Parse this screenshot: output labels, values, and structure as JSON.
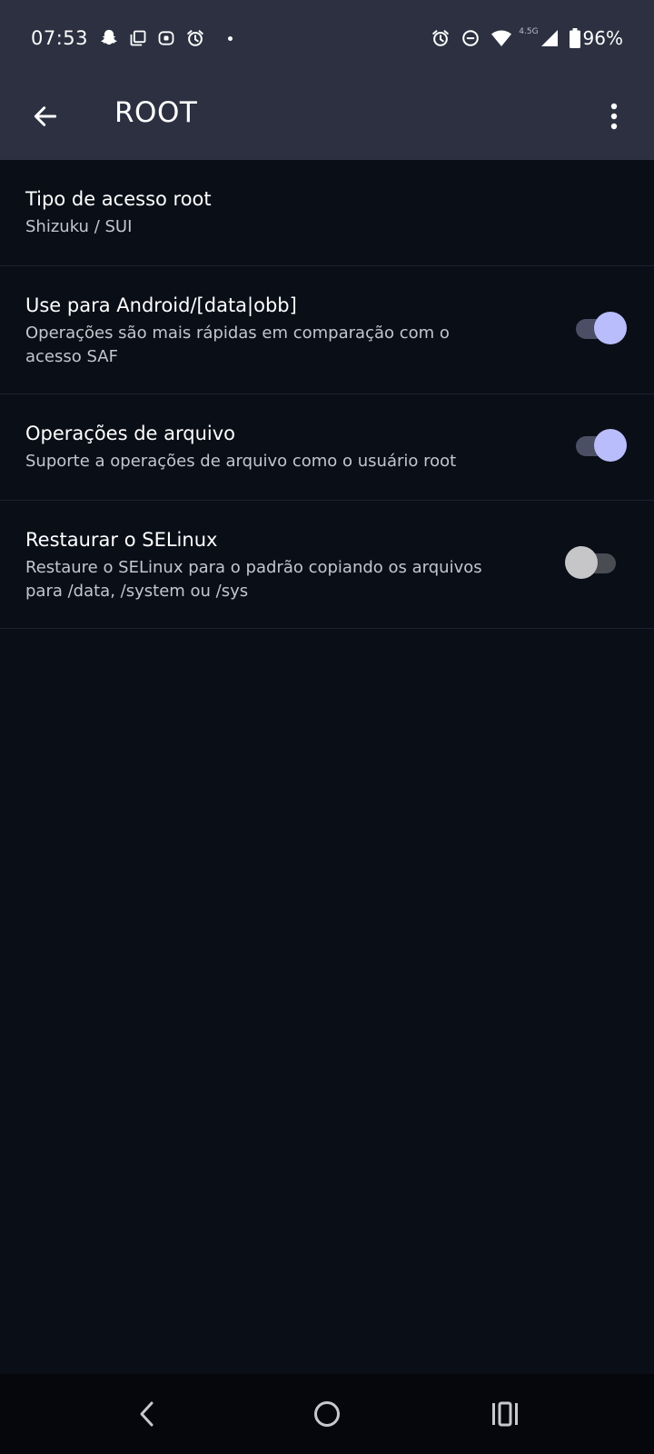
{
  "status_bar": {
    "time": "07:53",
    "left_icons": [
      "snapchat-icon",
      "copy-icon",
      "screen-record-icon",
      "alarm-icon",
      "dot-icon"
    ],
    "right_icons": [
      "alarm-icon",
      "do-not-disturb-icon",
      "wifi-icon",
      "cell-signal-icon",
      "battery-icon"
    ],
    "network_label": "4.5G",
    "battery": "96%"
  },
  "app_bar": {
    "title": "ROOT",
    "back_icon": "arrow-back-icon",
    "menu_icon": "more-vert-icon"
  },
  "preferences": [
    {
      "title": "Tipo de acesso root",
      "subtitle": "Shizuku / SUI",
      "has_toggle": false
    },
    {
      "title": "Use para Android/[data|obb]",
      "subtitle": "Operações são mais rápidas em comparação com o acesso SAF",
      "has_toggle": true,
      "toggle_on": true
    },
    {
      "title": "Operações de arquivo",
      "subtitle": "Suporte a operações de arquivo como o usuário root",
      "has_toggle": true,
      "toggle_on": true
    },
    {
      "title": "Restaurar o SELinux",
      "subtitle": "Restaure o SELinux para o padrão copiando os arquivos para /data, /system ou /sys",
      "has_toggle": true,
      "toggle_on": false
    }
  ],
  "nav_bar": {
    "buttons": [
      "nav-back-icon",
      "nav-home-icon",
      "nav-recents-icon"
    ]
  },
  "colors": {
    "header": "#2c3040",
    "background": "#0a0e17",
    "toggle_on_thumb": "#b9bdfb",
    "toggle_off_thumb": "#c6c6c8"
  }
}
